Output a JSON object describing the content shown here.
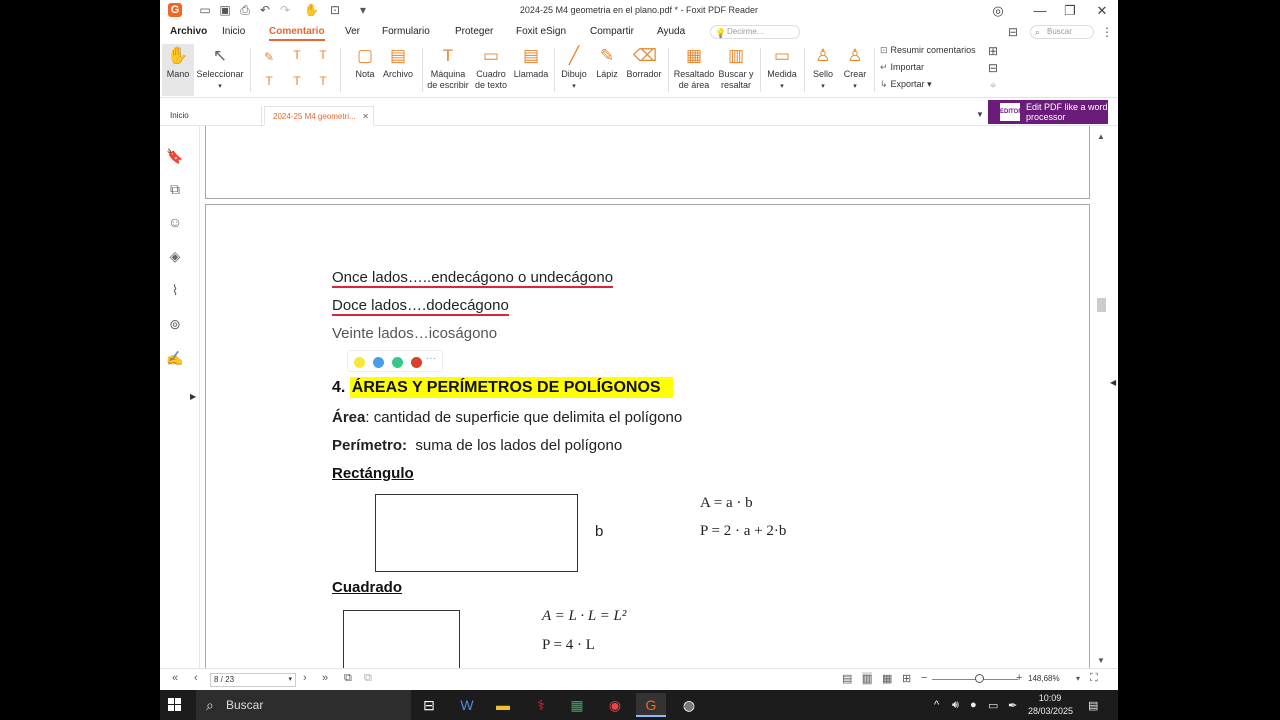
{
  "window": {
    "title": "2024-25 M4 geometria en el plano.pdf * - Foxit PDF Reader",
    "logo": "G"
  },
  "menu": {
    "items": [
      "Archivo",
      "Inicio",
      "Comentario",
      "Ver",
      "Formulario",
      "Proteger",
      "Foxit eSign",
      "Compartir",
      "Ayuda"
    ],
    "active": "Comentario",
    "tell_me_placeholder": "Decirme...",
    "search_placeholder": "Buscar"
  },
  "ribbon": {
    "hand": "Mano",
    "select": "Seleccionar",
    "note": "Nota",
    "file": "Archivo",
    "typewriter": [
      "Máquina",
      "de escribir"
    ],
    "textbox": [
      "Cuadro",
      "de texto"
    ],
    "callout": "Llamada",
    "drawing": "Dibujo",
    "pencil": "Lápiz",
    "eraser": "Borrador",
    "area_highlight": [
      "Resaltado",
      "de área"
    ],
    "search_highlight": [
      "Buscar y",
      "resaltar"
    ],
    "measure": "Medida",
    "stamp": "Sello",
    "create": "Crear",
    "summarize": "Resumir comentarios",
    "import": "Importar",
    "export": "Exportar"
  },
  "tabs": {
    "home": "Inicio",
    "doc": "2024-25 M4 geometri..."
  },
  "promo": {
    "badge": "EDITOR",
    "text": "Edit PDF like a word processor"
  },
  "document": {
    "lines": [
      "Once lados…..endecágono o undecágono",
      "Doce lados….dodecágono",
      "Veinte lados…icoságono"
    ],
    "heading_num": "4.",
    "heading_text": "ÁREAS Y PERÍMETROS DE POLÍGONOS",
    "area_label": "Área",
    "area_text": ": cantidad de superficie que delimita el polígono",
    "perimeter_label": "Perímetro:",
    "perimeter_text": "  suma de los lados del polígono",
    "rect_title": "Rectángulo",
    "rect_side": "b",
    "rect_area_formula": "A = a · b",
    "rect_perim_formula": "P = 2 · a + 2·b",
    "square_title": "Cuadrado",
    "square_area_formula": "A = L · L = L²",
    "square_perim_formula": "P = 4 · L"
  },
  "palette": {
    "colors": [
      "#f5e83a",
      "#4a9ee8",
      "#34c98a",
      "#d9412a"
    ],
    "more": "···"
  },
  "status": {
    "page": "8 / 23",
    "zoom": "148,68%"
  },
  "taskbar": {
    "search": "Buscar",
    "time": "10:09",
    "date": "28/03/2025"
  }
}
